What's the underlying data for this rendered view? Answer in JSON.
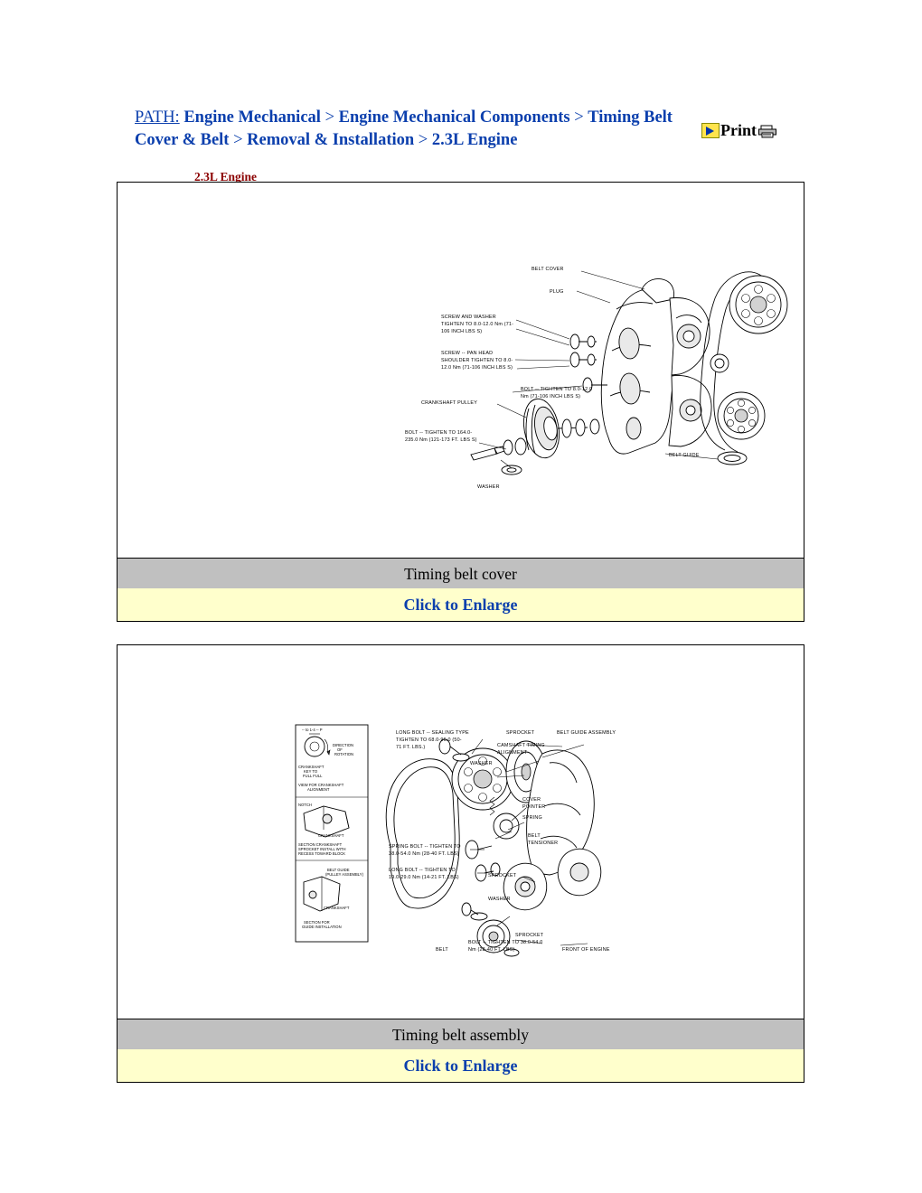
{
  "header": {
    "path_label": "PATH:",
    "path_segments": [
      "Engine Mechanical",
      "Engine Mechanical Components",
      "Timing Belt Cover & Belt",
      "Removal & Installation",
      "2.3L Engine"
    ],
    "path_separator": " > ",
    "print_label": "Print",
    "print_arrow_icon": "yellow-arrow-icon",
    "printer_icon": "printer-icon"
  },
  "section": {
    "title": "2.3L Engine"
  },
  "figures": [
    {
      "id": "figure-1",
      "caption": "Timing belt cover",
      "enlarge_label": "Click to Enlarge",
      "callouts": [
        "BELT COVER",
        "PLUG",
        "SCREW AND WASHER",
        "TIGHTEN TO 8.0-12.0 Nm (71-",
        "106 INCH LBS S)",
        "SCREW  --  PAN HEAD",
        "SHOULDER TIGHTEN TO 8.0-",
        "12.0 Nm (71-106 INCH LBS S)",
        "BOLT  --  TIGHTEN TO 8.0-12.0",
        "Nm (71-106 INCH LBS S)",
        "CRANKSHAFT PULLEY",
        "BOLT  --  TIGHTEN TO 164.0-",
        "235.0 Nm (121-173 FT. LBS S)",
        "WASHER",
        "BELT GUIDE"
      ]
    },
    {
      "id": "figure-2",
      "caption": "Timing belt assembly",
      "enlarge_label": "Click to Enlarge",
      "callouts": [
        "LONG BOLT  --  SEALING TYPE",
        "TIGHTEN TO 68.0-96.0 (50-",
        "71 FT. LBS.)",
        "SPROCKET",
        "BELT GUIDE ASSEMBLY",
        "CAMSHAFT TIMING",
        "ALIGNMENT",
        "WASHER",
        "COVER",
        "POINTER",
        "SPRING",
        "BELT",
        "TENSIONER",
        "SPRING BOLT  --  TIGHTEN TO",
        "38.0-54.0 Nm (28-40 FT. LBS)",
        "LONG BOLT  --  TIGHTEN TO",
        "19.0-29.0 Nm (14-21 FT. LBS)",
        "SPROCKET",
        "WASHER",
        "SPROCKET",
        "BELT",
        "BOLT  --  TIGHTEN TO 38.0-54.0",
        "Nm (28-40 FT. LBS)",
        "FRONT OF ENGINE",
        "DIRECTION OF ROTATION",
        "CRANKSHAFT",
        "KEY TO",
        "FULL FULL",
        "VIEW FOR CRANKSHAFT",
        "ALIGNMENT",
        "NOTCH",
        "CRANKSHAFT",
        "SECTION  CRANKSHAFT",
        "SPROCKET  INSTALL WITH",
        "RECESS TOWARD BLOCK",
        "BELT GUIDE",
        "(PULLEY ASSEMBLY)",
        "CRANKSHAFT",
        "SECTION FOR",
        "GUIDE INSTALLATION"
      ]
    }
  ]
}
